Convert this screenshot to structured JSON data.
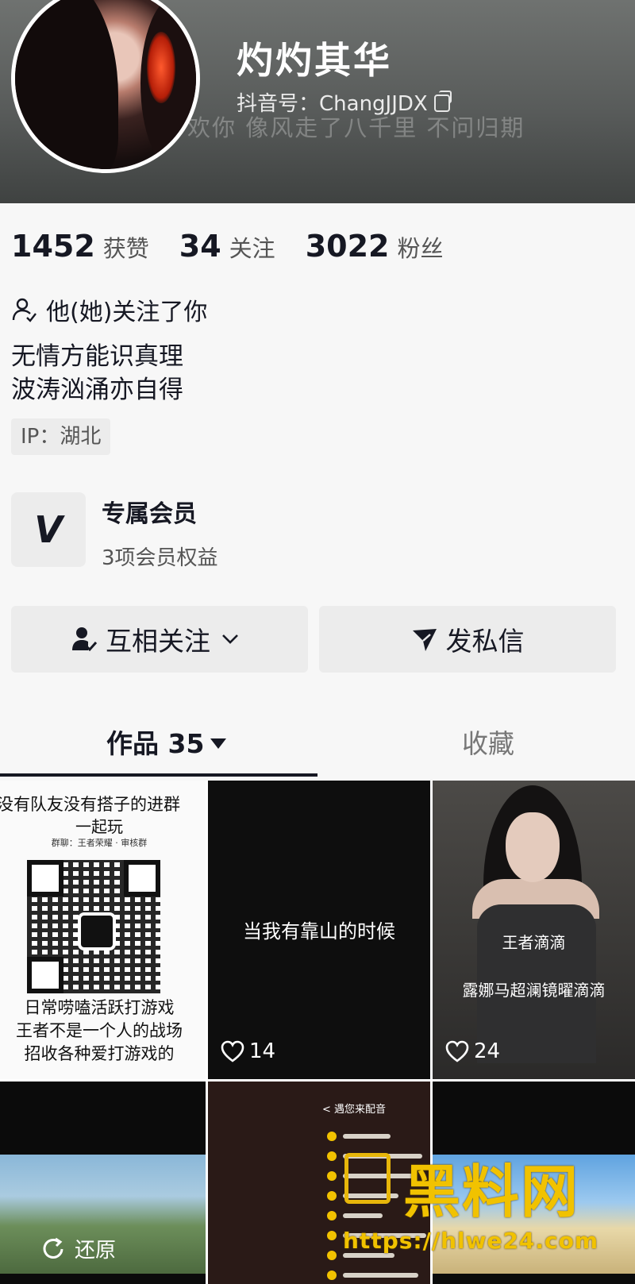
{
  "profile": {
    "name": "灼灼其华",
    "douyin_id": "抖音号：ChangJJDX",
    "bio_ghost": "欢你  像风走了八千里  不问归期",
    "stats": [
      {
        "num": "1452",
        "label": "获赞"
      },
      {
        "num": "34",
        "label": "关注"
      },
      {
        "num": "3022",
        "label": "粉丝"
      }
    ],
    "follows_you": "他(她)关注了你",
    "bio_line1": "无情方能识真理",
    "bio_line2": "波涛汹涌亦自得",
    "ip": "IP：湖北"
  },
  "vip": {
    "title": "专属会员",
    "subtitle": "3项会员权益",
    "icon": "V"
  },
  "actions": {
    "follow": "互相关注",
    "message": "发私信"
  },
  "tabs": {
    "works": "作品 35",
    "favorites": "收藏"
  },
  "grid": {
    "c1": {
      "line1": "没有队友没有搭子的进群",
      "line2": "一起玩",
      "line3": "群聊：王者荣耀 · 审核群",
      "line4": "日常唠嗑活跃打游戏",
      "line5": "王者不是一个人的战场",
      "line6": "招收各种爱打游戏的"
    },
    "c2": {
      "text": "当我有靠山的时候",
      "likes": "14"
    },
    "c3": {
      "text1": "王者滴滴",
      "text2": "露娜马超澜镜曜滴滴",
      "likes": "24"
    },
    "c4": {
      "restore": "还原"
    },
    "c5": {
      "header": "< 遇您来配音"
    }
  },
  "watermark": {
    "text": "黑料网",
    "url": "https://hlwe24.com"
  },
  "colors": {
    "accent_yellow": "#f1c200",
    "header_gray": "#585b5a"
  }
}
